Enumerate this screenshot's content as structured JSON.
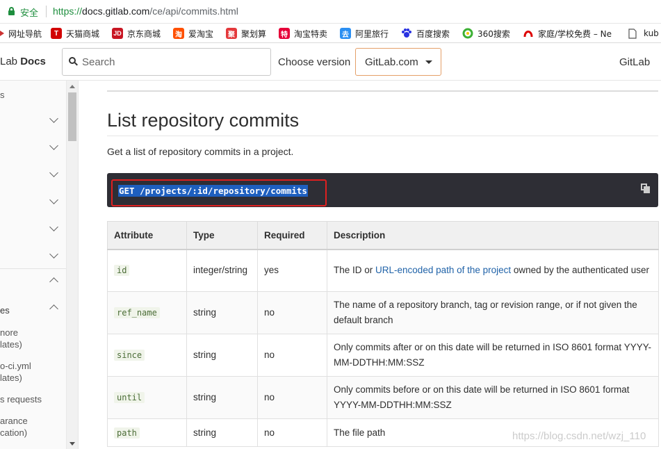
{
  "browser": {
    "secure_label": "安全",
    "url_proto": "https://",
    "url_host": "docs.gitlab.com",
    "url_path": "/ce/api/commits.html"
  },
  "bookmarks": [
    {
      "label": "网址导航",
      "icon": "compass-icon",
      "glyph": "",
      "color": "#ffffff"
    },
    {
      "label": "天猫商城",
      "icon": "tmall-icon",
      "glyph": "T",
      "color": "#d20000"
    },
    {
      "label": "京东商城",
      "icon": "jd-icon",
      "glyph": "JD",
      "color": "#c81623"
    },
    {
      "label": "爱淘宝",
      "icon": "taobao-icon",
      "glyph": "淘",
      "color": "#ff5000"
    },
    {
      "label": "聚划算",
      "icon": "juhuasuan-icon",
      "glyph": "聚",
      "color": "#e4393c"
    },
    {
      "label": "淘宝特卖",
      "icon": "temai-icon",
      "glyph": "特",
      "color": "#e60039"
    },
    {
      "label": "阿里旅行",
      "icon": "alitrip-icon",
      "glyph": "去",
      "color": "#2b8ff2"
    },
    {
      "label": "百度搜索",
      "icon": "baidu-icon",
      "glyph": "",
      "color": "#ffffff"
    },
    {
      "label": "360搜索",
      "icon": "360-icon",
      "glyph": "",
      "color": "#ffffff"
    },
    {
      "label": "家庭/学校免费 – Ne",
      "icon": "netease-icon",
      "glyph": "",
      "color": "#ffffff"
    },
    {
      "label": "kub",
      "icon": "page-icon",
      "glyph": "",
      "color": "#ffffff"
    }
  ],
  "header": {
    "brand_prefix": "Lab",
    "brand_suffix": "Docs",
    "search_placeholder": "Search",
    "choose_version": "Choose version",
    "version_value": "GitLab.com",
    "gitlab_link": "GitLab"
  },
  "sidebar": {
    "fragments": [
      "s",
      "es",
      "nore",
      "lates)",
      "o-ci.yml",
      "lates)",
      "s requests",
      "arance",
      "cation)"
    ]
  },
  "content": {
    "title": "List repository commits",
    "intro": "Get a list of repository commits in a project.",
    "endpoint": "GET /projects/:id/repository/commits",
    "columns": [
      "Attribute",
      "Type",
      "Required",
      "Description"
    ],
    "rows": [
      {
        "attr": "id",
        "type": "integer/string",
        "required": "yes",
        "desc_pre": "The ID or ",
        "desc_link": "URL-encoded path of the project",
        "desc_post": " owned by the authenticated user"
      },
      {
        "attr": "ref_name",
        "type": "string",
        "required": "no",
        "desc_pre": "The name of a repository branch, tag or revision range, or if not given the default branch",
        "desc_link": "",
        "desc_post": ""
      },
      {
        "attr": "since",
        "type": "string",
        "required": "no",
        "desc_pre": "Only commits after or on this date will be returned in ISO 8601 format YYYY-MM-DDTHH:MM:SSZ",
        "desc_link": "",
        "desc_post": ""
      },
      {
        "attr": "until",
        "type": "string",
        "required": "no",
        "desc_pre": "Only commits before or on this date will be returned in ISO 8601 format YYYY-MM-DDTHH:MM:SSZ",
        "desc_link": "",
        "desc_post": ""
      },
      {
        "attr": "path",
        "type": "string",
        "required": "no",
        "desc_pre": "The file path",
        "desc_link": "",
        "desc_post": ""
      }
    ]
  },
  "watermark": "https://blog.csdn.net/wzj_110"
}
